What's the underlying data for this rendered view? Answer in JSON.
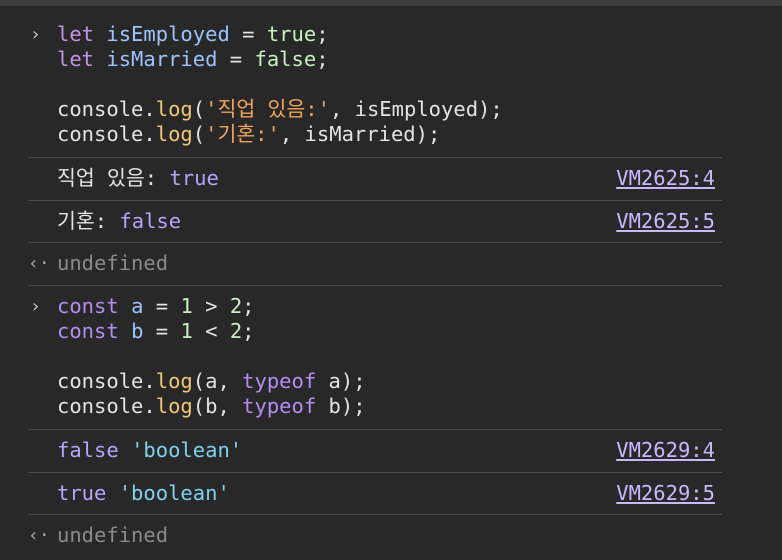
{
  "blocks": [
    {
      "input_lines": [
        [
          [
            "let",
            "kw"
          ],
          [
            " ",
            "plain"
          ],
          [
            "isEmployed",
            "var"
          ],
          [
            " = ",
            "plain"
          ],
          [
            "true",
            "num"
          ],
          [
            ";",
            "plain"
          ]
        ],
        [
          [
            "let",
            "kw"
          ],
          [
            " ",
            "plain"
          ],
          [
            "isMarried",
            "var"
          ],
          [
            " = ",
            "plain"
          ],
          [
            "false",
            "num"
          ],
          [
            ";",
            "plain"
          ]
        ],
        [],
        [
          [
            "console",
            "plain"
          ],
          [
            ".",
            "plain"
          ],
          [
            "log",
            "fn"
          ],
          [
            "(",
            "plain"
          ],
          [
            "'직업 있음:'",
            "str"
          ],
          [
            ", isEmployed);",
            "plain"
          ]
        ],
        [
          [
            "console",
            "plain"
          ],
          [
            ".",
            "plain"
          ],
          [
            "log",
            "fn"
          ],
          [
            "(",
            "plain"
          ],
          [
            "'기혼:'",
            "str"
          ],
          [
            ", isMarried);",
            "plain"
          ]
        ]
      ],
      "outputs": [
        {
          "parts": [
            [
              "직업 있음: ",
              "plain"
            ],
            [
              "true",
              "bool"
            ]
          ],
          "source": "VM2625:4"
        },
        {
          "parts": [
            [
              "기혼: ",
              "plain"
            ],
            [
              "false",
              "bool"
            ]
          ],
          "source": "VM2625:5"
        }
      ],
      "result": "undefined"
    },
    {
      "input_lines": [
        [
          [
            "const",
            "kw2"
          ],
          [
            " ",
            "plain"
          ],
          [
            "a",
            "var"
          ],
          [
            " = ",
            "plain"
          ],
          [
            "1",
            "num"
          ],
          [
            " > ",
            "plain"
          ],
          [
            "2",
            "num"
          ],
          [
            ";",
            "plain"
          ]
        ],
        [
          [
            "const",
            "kw2"
          ],
          [
            " ",
            "plain"
          ],
          [
            "b",
            "var"
          ],
          [
            " = ",
            "plain"
          ],
          [
            "1",
            "num"
          ],
          [
            " < ",
            "plain"
          ],
          [
            "2",
            "num"
          ],
          [
            ";",
            "plain"
          ]
        ],
        [],
        [
          [
            "console",
            "plain"
          ],
          [
            ".",
            "plain"
          ],
          [
            "log",
            "fn"
          ],
          [
            "(a, ",
            "plain"
          ],
          [
            "typeof",
            "kw2"
          ],
          [
            " a);",
            "plain"
          ]
        ],
        [
          [
            "console",
            "plain"
          ],
          [
            ".",
            "plain"
          ],
          [
            "log",
            "fn"
          ],
          [
            "(b, ",
            "plain"
          ],
          [
            "typeof",
            "kw2"
          ],
          [
            " b);",
            "plain"
          ]
        ]
      ],
      "outputs": [
        {
          "parts": [
            [
              "false",
              "bool"
            ],
            [
              " ",
              "plain"
            ],
            [
              "'boolean'",
              "strval"
            ]
          ],
          "source": "VM2629:4"
        },
        {
          "parts": [
            [
              "true",
              "bool"
            ],
            [
              " ",
              "plain"
            ],
            [
              "'boolean'",
              "strval"
            ]
          ],
          "source": "VM2629:5"
        }
      ],
      "result": "undefined"
    }
  ],
  "icons": {
    "prompt": "›",
    "result": "‹·"
  },
  "colors": {
    "background": "#282828",
    "divider": "#4a4a4a",
    "link": "#c9b8ff"
  }
}
